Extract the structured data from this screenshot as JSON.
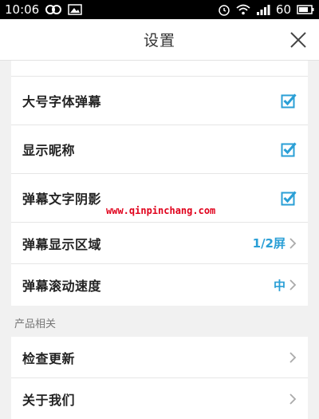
{
  "status_bar": {
    "time": "10:06",
    "battery_level": "60",
    "icons_left": [
      "infinity-icon",
      "image-icon"
    ],
    "icons_right": [
      "alarm-icon",
      "wifi-icon",
      "signal-icon",
      "battery-icon"
    ]
  },
  "header": {
    "title": "设置",
    "close_icon": "close-icon"
  },
  "danmaku_settings": [
    {
      "label": "大号字体弹幕",
      "checked": true
    },
    {
      "label": "显示昵称",
      "checked": true
    },
    {
      "label": "弹幕文字阴影",
      "checked": true
    },
    {
      "label": "弹幕显示区域",
      "value": "1/2屏"
    },
    {
      "label": "弹幕滚动速度",
      "value": "中"
    }
  ],
  "product_section": {
    "header": "产品相关",
    "items": [
      {
        "label": "检查更新"
      },
      {
        "label": "关于我们"
      }
    ]
  },
  "watermark": "www.qinpinchang.com",
  "colors": {
    "accent": "#2a9fd6",
    "background": "#f1f1f1",
    "watermark": "#e0001b"
  }
}
